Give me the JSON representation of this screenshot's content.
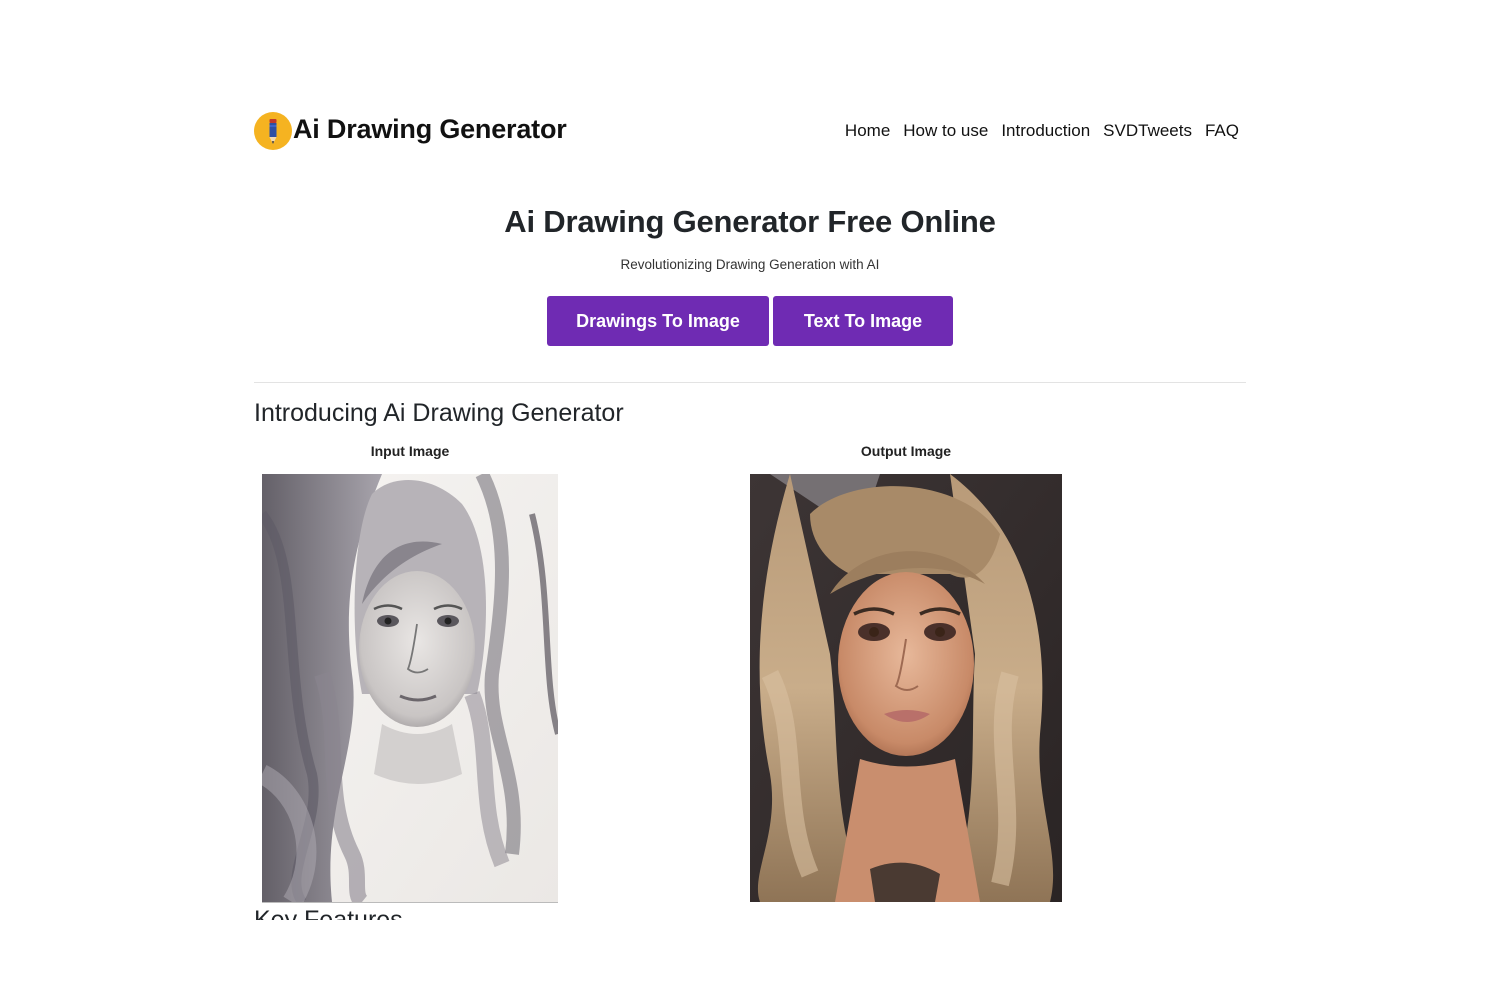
{
  "header": {
    "brand": "Ai Drawing Generator",
    "logo_icon": "pencil-icon",
    "nav": [
      "Home",
      "How to use",
      "Introduction",
      "SVDTweets",
      "FAQ"
    ]
  },
  "hero": {
    "title": "Ai Drawing Generator Free Online",
    "subtitle": "Revolutionizing Drawing Generation with AI",
    "buttons": {
      "drawings_to_image": "Drawings To Image",
      "text_to_image": "Text To Image"
    }
  },
  "intro": {
    "title": "Introducing Ai Drawing Generator",
    "input_label": "Input Image",
    "output_label": "Output Image"
  },
  "next_section": {
    "title": "Key Features"
  },
  "colors": {
    "accent": "#6f2bb3",
    "logo": "#f5b321",
    "text": "#212529"
  }
}
